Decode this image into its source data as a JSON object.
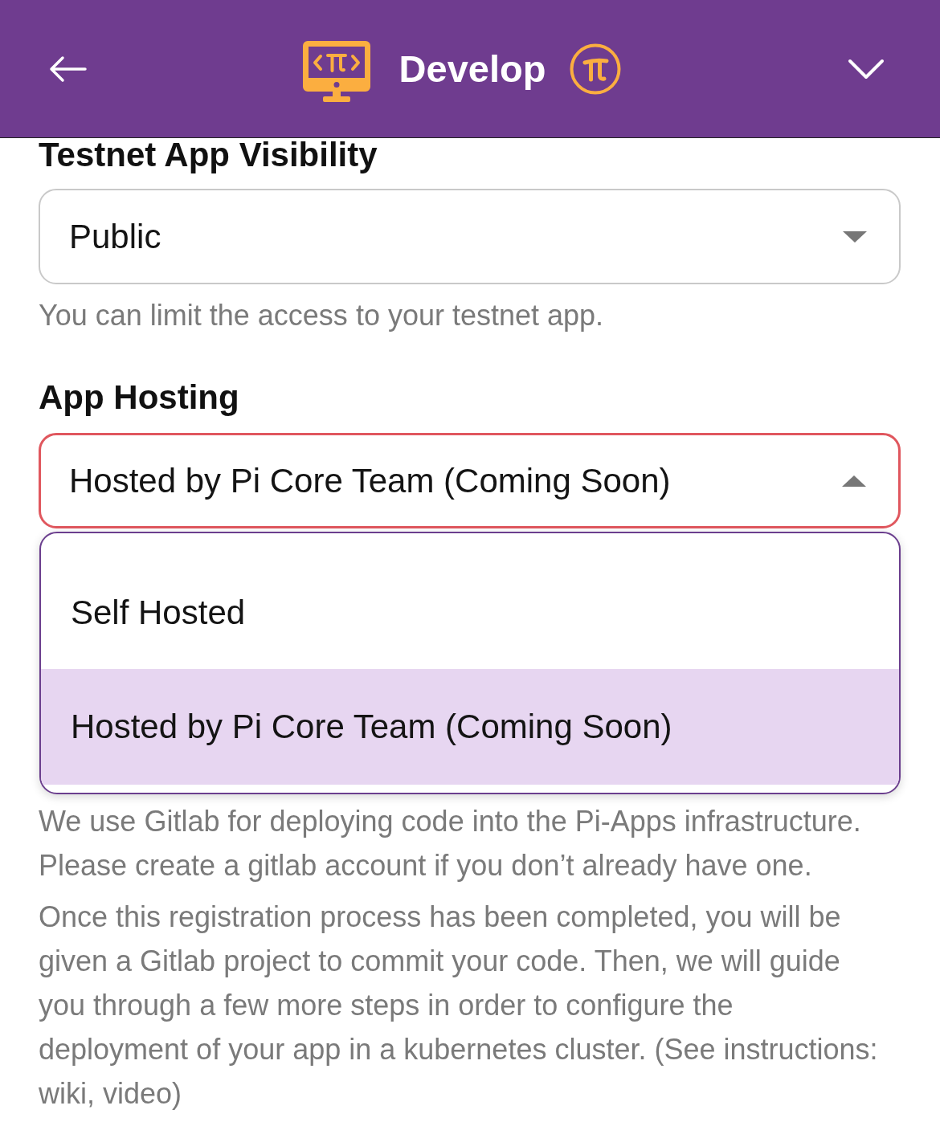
{
  "header": {
    "title": "Develop"
  },
  "fields": [
    {
      "label": "Testnet App Visibility",
      "value": "Public",
      "open": false,
      "hint": "You can limit the access to your testnet app."
    },
    {
      "label": "App Hosting",
      "value": "Hosted by Pi Core Team (Coming Soon)",
      "open": true,
      "options": [
        {
          "label": "Self Hosted",
          "selected": false
        },
        {
          "label": "Hosted by Pi Core Team (Coming Soon)",
          "selected": true
        }
      ]
    }
  ],
  "paragraphs": [
    "We use Gitlab for deploying code into the Pi-Apps infrastructure. Please create a gitlab account if you don’t already have one.",
    "Once this registration process has been completed, you will be given a Gitlab project to commit your code. Then, we will guide you through a few more steps in order to configure the deployment of your app in a kubernetes cluster. (See instructions: wiki, video)"
  ]
}
